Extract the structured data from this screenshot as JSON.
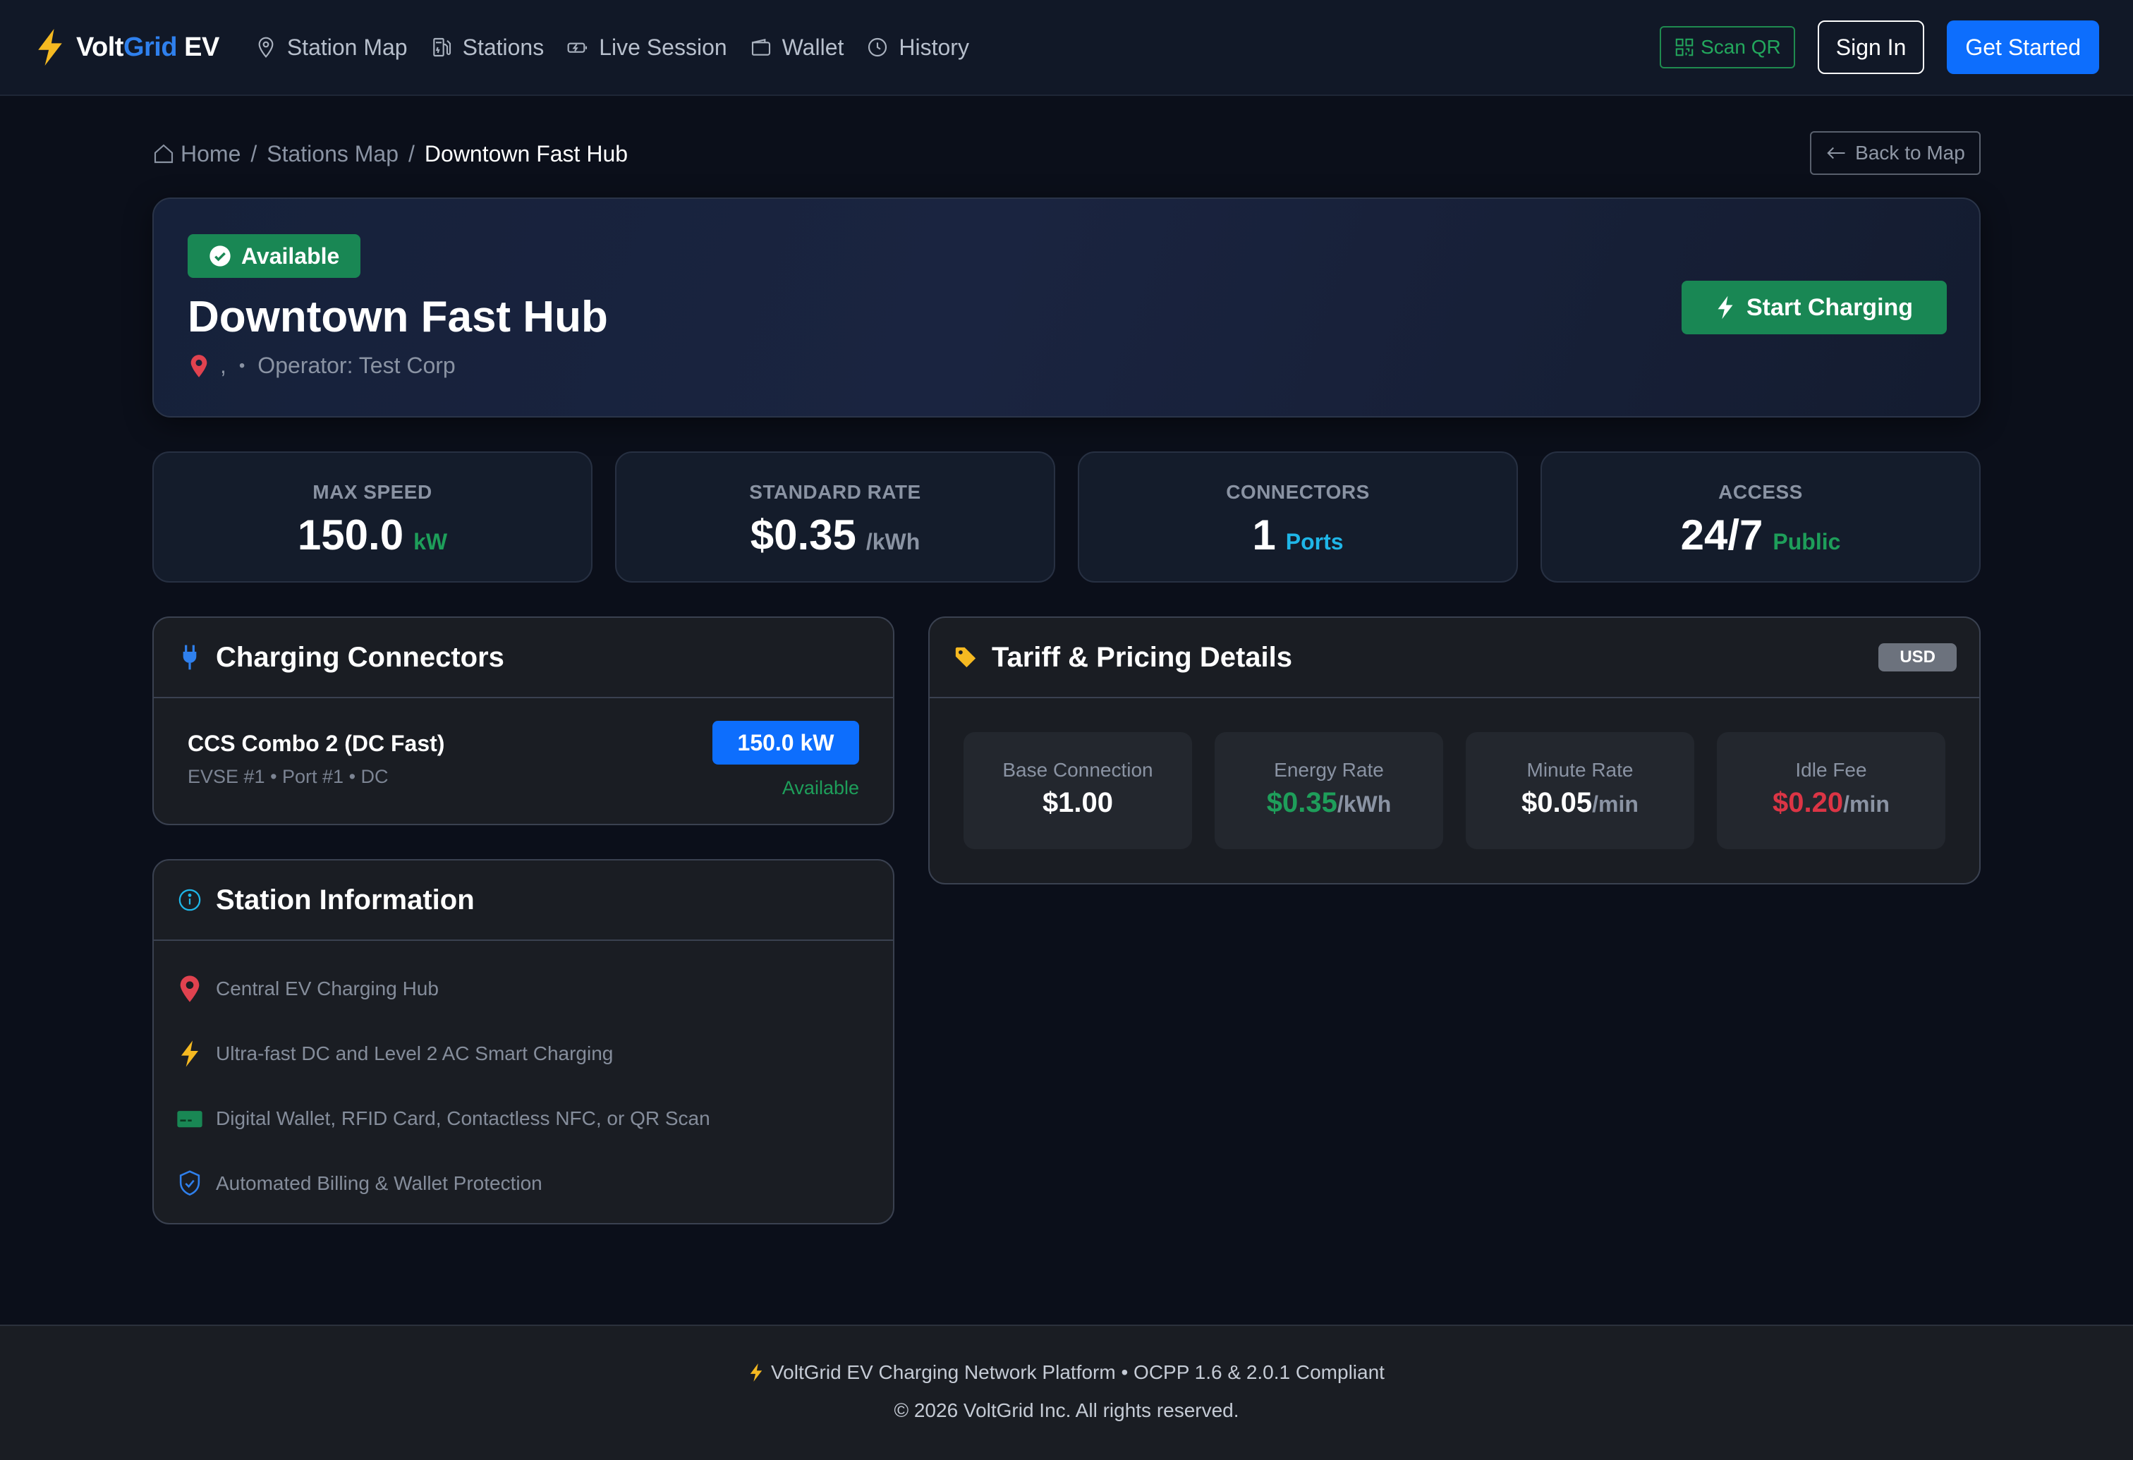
{
  "brand": {
    "part1": "Volt",
    "part2": "Grid",
    "part3": " EV"
  },
  "nav": {
    "links": [
      {
        "label": "Station Map",
        "icon": "map-pin-icon"
      },
      {
        "label": "Stations",
        "icon": "fuel-pump-icon"
      },
      {
        "label": "Live Session",
        "icon": "charging-icon"
      },
      {
        "label": "Wallet",
        "icon": "wallet-icon"
      },
      {
        "label": "History",
        "icon": "clock-icon"
      }
    ],
    "scan_qr": "Scan QR",
    "sign_in": "Sign In",
    "get_started": "Get Started"
  },
  "breadcrumb": {
    "home": "Home",
    "sep": "/",
    "stations_map": "Stations Map",
    "current": "Downtown Fast Hub",
    "back": "Back to Map"
  },
  "station": {
    "status": "Available",
    "name": "Downtown Fast Hub",
    "address": ",",
    "separator": "•",
    "operator": "Operator: Test Corp",
    "start_button": "Start Charging"
  },
  "stats": [
    {
      "label": "MAX SPEED",
      "value": "150.0",
      "unit": "kW",
      "unit_color": "green"
    },
    {
      "label": "STANDARD RATE",
      "value": "$0.35",
      "unit": "/kWh",
      "unit_color": "grey"
    },
    {
      "label": "CONNECTORS",
      "value": "1",
      "unit": "Ports",
      "unit_color": "cyan"
    },
    {
      "label": "ACCESS",
      "value": "24/7",
      "unit": "Public",
      "unit_color": "green"
    }
  ],
  "connectors_panel": {
    "title": "Charging Connectors",
    "connector": {
      "name": "CCS Combo 2 (DC Fast)",
      "details": "EVSE #1 • Port #1 • DC",
      "power": "150.0 kW",
      "status": "Available"
    }
  },
  "info_panel": {
    "title": "Station Information",
    "items": [
      {
        "text": "Central EV Charging Hub",
        "icon": "location-icon"
      },
      {
        "text": "Ultra-fast DC and Level 2 AC Smart Charging",
        "icon": "bolt-icon"
      },
      {
        "text": "Digital Wallet, RFID Card, Contactless NFC, or QR Scan",
        "icon": "card-icon"
      },
      {
        "text": "Automated Billing & Wallet Protection",
        "icon": "shield-icon"
      }
    ]
  },
  "tariff_panel": {
    "title": "Tariff & Pricing Details",
    "currency": "USD",
    "items": [
      {
        "label": "Base Connection",
        "value": "$1.00",
        "suffix": ""
      },
      {
        "label": "Energy Rate",
        "value": "$0.35",
        "suffix": "/kWh"
      },
      {
        "label": "Minute Rate",
        "value": "$0.05",
        "suffix": "/min"
      },
      {
        "label": "Idle Fee",
        "value": "$0.20",
        "suffix": "/min"
      }
    ]
  },
  "footer": {
    "line1": "VoltGrid EV Charging Network Platform • OCPP 1.6 & 2.0.1 Compliant",
    "line2": "© 2026 VoltGrid Inc. All rights reserved."
  },
  "colors": {
    "background": "#0b0f1a",
    "primary": "#0d6efd",
    "success": "#198754",
    "danger": "#dc3545",
    "warning": "#f5b921"
  }
}
